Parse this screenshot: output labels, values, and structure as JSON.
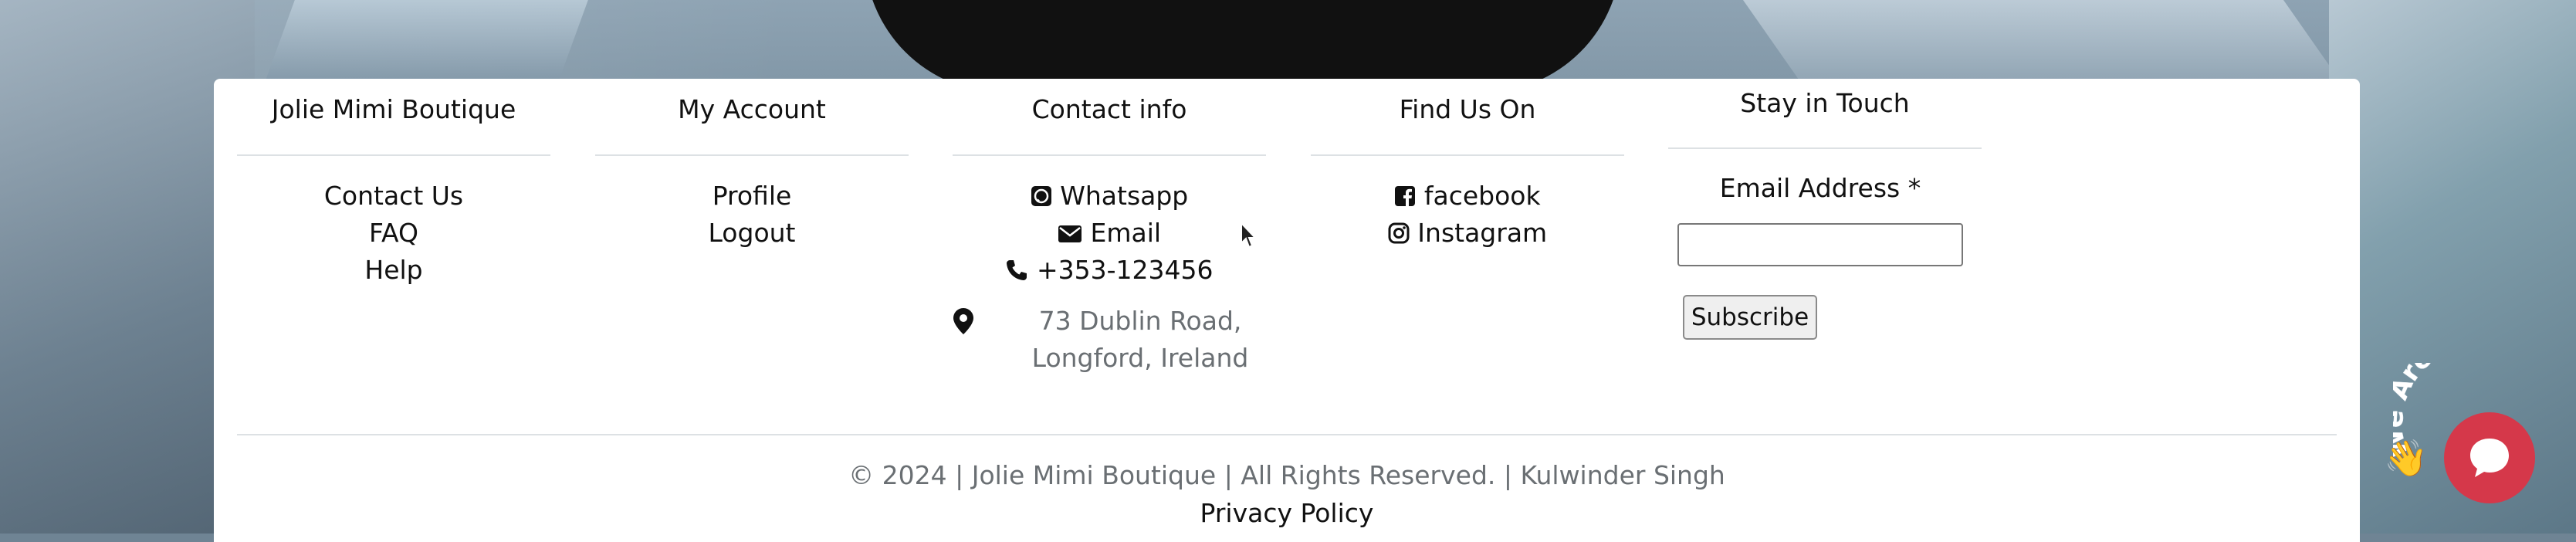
{
  "columns": {
    "brand": {
      "title": "Jolie Mimi Boutique",
      "links": [
        "Contact Us",
        "FAQ",
        "Help"
      ]
    },
    "account": {
      "title": "My Account",
      "links": [
        "Profile",
        "Logout"
      ]
    },
    "contact": {
      "title": "Contact info",
      "whatsapp": "Whatsapp",
      "email": "Email",
      "phone": "+353-123456",
      "address_line1": "73 Dublin Road,",
      "address_line2": "Longford, Ireland"
    },
    "social": {
      "title": "Find Us On",
      "facebook": "facebook",
      "instagram": "Instagram"
    },
    "newsletter": {
      "title": "Stay in Touch",
      "email_label": "Email Address *",
      "email_value": "",
      "subscribe_label": "Subscribe"
    }
  },
  "footer": {
    "copyright": "© 2024 | Jolie Mimi Boutique | All Rights Reserved. | Kulwinder Singh",
    "privacy": "Privacy Policy"
  },
  "chat_widget": {
    "badge_text": "We Are Here!",
    "accent_color": "#d5384a"
  },
  "icons": [
    "whatsapp-icon",
    "envelope-icon",
    "phone-icon",
    "map-marker-icon",
    "facebook-icon",
    "instagram-icon",
    "chat-icon",
    "waving-hand-icon"
  ]
}
